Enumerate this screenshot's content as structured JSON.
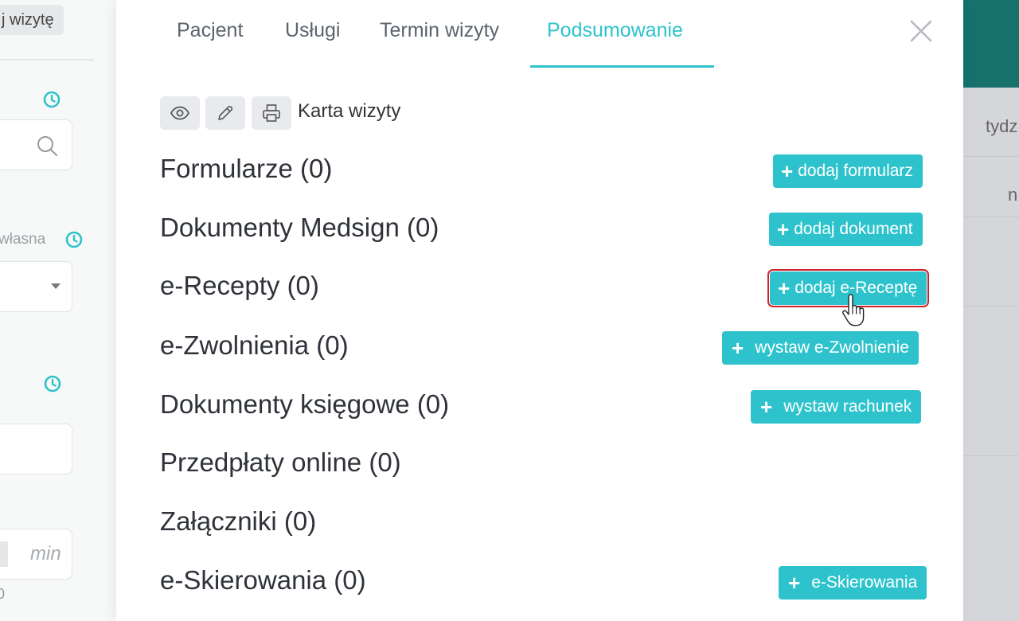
{
  "left_panel": {
    "chip_text": "j wizytę",
    "label_text": "własna",
    "min_text": "min",
    "zero_text": "0"
  },
  "right_panel": {
    "text1": "tydz",
    "text2": "n"
  },
  "modal": {
    "tabs": [
      {
        "label": "Pacjent"
      },
      {
        "label": "Usługi"
      },
      {
        "label": "Termin wizyty"
      },
      {
        "label": "Podsumowanie"
      }
    ],
    "toolbar": {
      "card_label": "Karta wizyty"
    },
    "sections": [
      {
        "title": "Formularze (0)",
        "button": "dodaj formularz"
      },
      {
        "title": "Dokumenty Medsign (0)",
        "button": "dodaj dokument"
      },
      {
        "title": "e-Recepty (0)",
        "button": "dodaj e-Receptę"
      },
      {
        "title": "e-Zwolnienia (0)",
        "button": "wystaw e-Zwolnienie"
      },
      {
        "title": "Dokumenty księgowe (0)",
        "button": "wystaw rachunek"
      },
      {
        "title": "Przedpłaty online (0)"
      },
      {
        "title": "Załączniki (0)"
      },
      {
        "title": "e-Skierowania (0)",
        "button": "e-Skierowania"
      }
    ]
  },
  "colors": {
    "accent": "#2ec3cc",
    "highlight": "#d0202a",
    "header_teal": "#16706c"
  }
}
